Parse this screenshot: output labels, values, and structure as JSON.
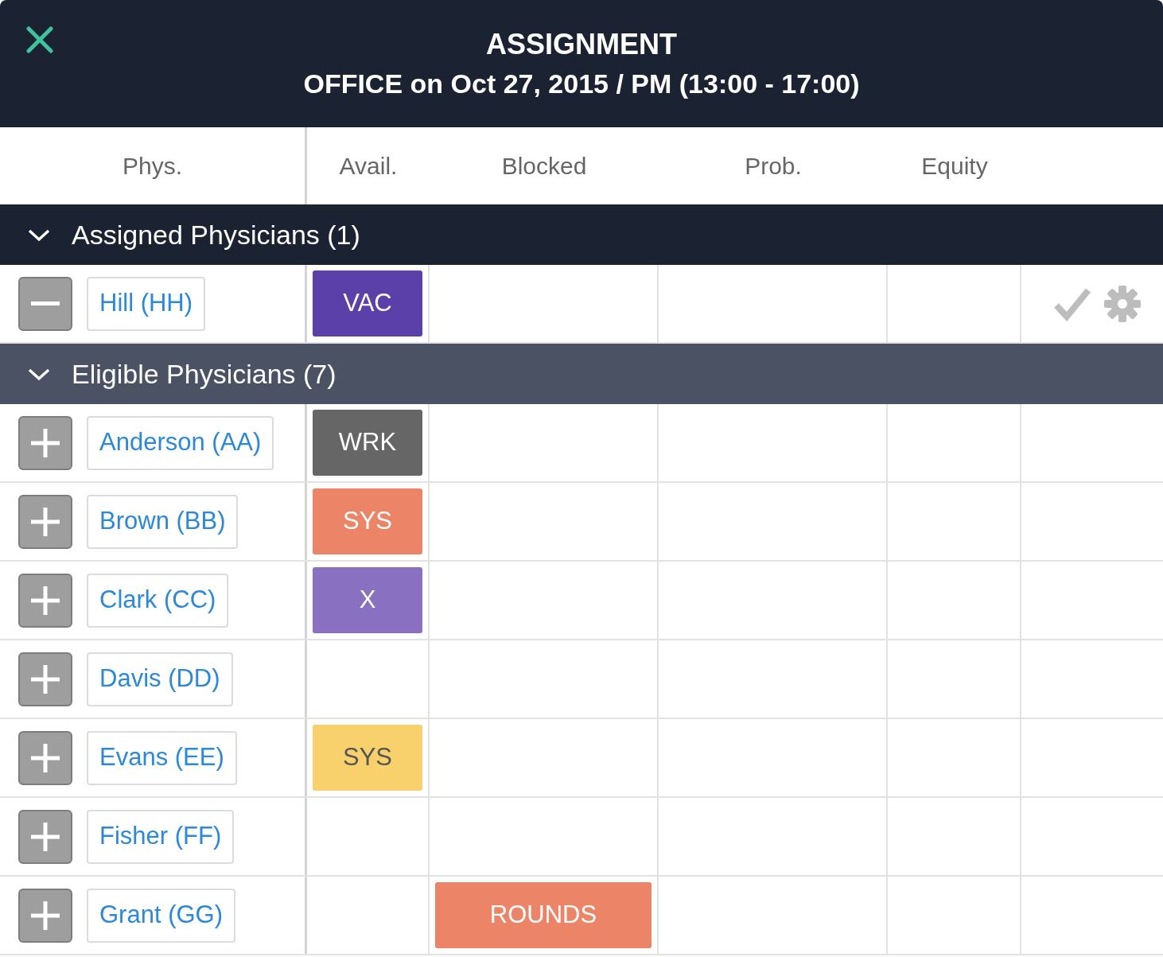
{
  "header": {
    "title": "ASSIGNMENT",
    "subtitle": "OFFICE on Oct 27, 2015 / PM (13:00 - 17:00)"
  },
  "columns": [
    "Phys.",
    "Avail.",
    "Blocked",
    "Prob.",
    "Equity"
  ],
  "groups": [
    {
      "label": "Assigned Physicians (1)",
      "kind": "assigned",
      "expanded": true,
      "rows": [
        {
          "name": "Hill (HH)",
          "kind": "remove",
          "avail": {
            "text": "VAC",
            "color": "#5c40a9"
          },
          "show_actions": true
        }
      ]
    },
    {
      "label": "Eligible Physicians (7)",
      "kind": "eligible",
      "expanded": true,
      "rows": [
        {
          "name": "Anderson (AA)",
          "kind": "add",
          "avail": {
            "text": "WRK",
            "color": "#666666"
          },
          "show_actions": false
        },
        {
          "name": "Brown (BB)",
          "kind": "add",
          "avail": {
            "text": "SYS",
            "color": "#ec8468"
          },
          "show_actions": false
        },
        {
          "name": "Clark (CC)",
          "kind": "add",
          "avail": {
            "text": "X",
            "color": "#8a70c0"
          },
          "show_actions": false
        },
        {
          "name": "Davis (DD)",
          "kind": "add",
          "show_actions": false
        },
        {
          "name": "Evans (EE)",
          "kind": "add",
          "avail": {
            "text": "SYS",
            "color": "#f8d06c"
          },
          "show_actions": false
        },
        {
          "name": "Fisher (FF)",
          "kind": "add",
          "show_actions": false
        },
        {
          "name": "Grant (GG)",
          "kind": "add",
          "blocked": {
            "text": "ROUNDS",
            "color": "#ec8468"
          },
          "show_actions": false
        }
      ]
    }
  ]
}
